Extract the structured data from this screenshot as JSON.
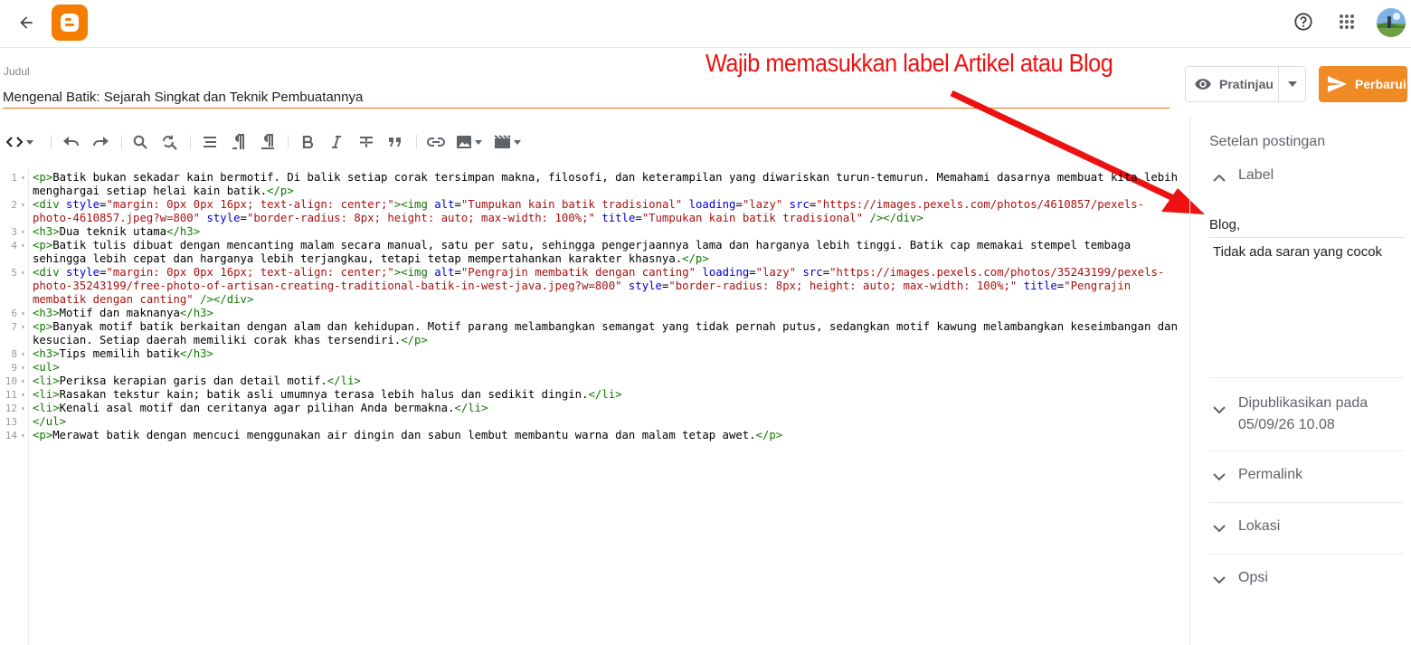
{
  "header": {
    "back_icon": "arrow-left-icon",
    "logo_icon": "blogger-logo",
    "help_icon": "help-circle-icon",
    "apps_icon": "apps-grid-icon"
  },
  "post": {
    "title_label": "Judul",
    "title_value": "Mengenal Batik: Sejarah Singkat dan Teknik Pembuatannya"
  },
  "annotation": {
    "text": "Wajib memasukkan label Artikel atau Blog",
    "color": "#ee1111"
  },
  "actions": {
    "preview_label": "Pratinjau",
    "publish_label": "Perbarui",
    "publish_color": "#f08a24"
  },
  "editor": {
    "lines": [
      {
        "n": "1",
        "text": "<p>Batik bukan sekadar kain bermotif. Di balik setiap corak tersimpan makna, filosofi, dan keterampilan yang diwariskan turun-temurun. Memahami dasarnya membuat kita lebih menghargai setiap helai kain batik.</p>"
      },
      {
        "n": "2",
        "text": "<div style=\"margin: 0px 0px 16px; text-align: center;\"><img alt=\"Tumpukan kain batik tradisional\" loading=\"lazy\" src=\"https://images.pexels.com/photos/4610857/pexels-photo-4610857.jpeg?w=800\" style=\"border-radius: 8px; height: auto; max-width: 100%;\" title=\"Tumpukan kain batik tradisional\" /></div>"
      },
      {
        "n": "3",
        "text": "<h3>Dua teknik utama</h3>"
      },
      {
        "n": "4",
        "text": "<p>Batik tulis dibuat dengan mencanting malam secara manual, satu per satu, sehingga pengerjaannya lama dan harganya lebih tinggi. Batik cap memakai stempel tembaga sehingga lebih cepat dan harganya lebih terjangkau, tetapi tetap mempertahankan karakter khasnya.</p>"
      },
      {
        "n": "5",
        "text": "<div style=\"margin: 0px 0px 16px; text-align: center;\"><img alt=\"Pengrajin membatik dengan canting\" loading=\"lazy\" src=\"https://images.pexels.com/photos/35243199/pexels-photo-35243199/free-photo-of-artisan-creating-traditional-batik-in-west-java.jpeg?w=800\" style=\"border-radius: 8px; height: auto; max-width: 100%;\" title=\"Pengrajin membatik dengan canting\" /></div>"
      },
      {
        "n": "6",
        "text": "<h3>Motif dan maknanya</h3>"
      },
      {
        "n": "7",
        "text": "<p>Banyak motif batik berkaitan dengan alam dan kehidupan. Motif parang melambangkan semangat yang tidak pernah putus, sedangkan motif kawung melambangkan keseimbangan dan kesucian. Setiap daerah memiliki corak khas tersendiri.</p>"
      },
      {
        "n": "8",
        "text": "<h3>Tips memilih batik</h3>"
      },
      {
        "n": "9",
        "text": "<ul>"
      },
      {
        "n": "10",
        "text": "<li>Periksa kerapian garis dan detail motif.</li>"
      },
      {
        "n": "11",
        "text": "<li>Rasakan tekstur kain; batik asli umumnya terasa lebih halus dan sedikit dingin.</li>"
      },
      {
        "n": "12",
        "text": "<li>Kenali asal motif dan ceritanya agar pilihan Anda bermakna.</li>"
      },
      {
        "n": "13",
        "text": "</ul>"
      },
      {
        "n": "14",
        "text": "<p>Merawat batik dengan mencuci menggunakan air dingin dan sabun lembut membantu warna dan malam tetap awet.</p>"
      }
    ]
  },
  "sidebar": {
    "title": "Setelan postingan",
    "label_section": {
      "title": "Label",
      "value": "Blog,",
      "suggestion": "Tidak ada saran yang cocok"
    },
    "published": {
      "title": "Dipublikasikan pada",
      "value": "05/09/26 10.08"
    },
    "permalink": "Permalink",
    "location": "Lokasi",
    "options": "Opsi"
  }
}
